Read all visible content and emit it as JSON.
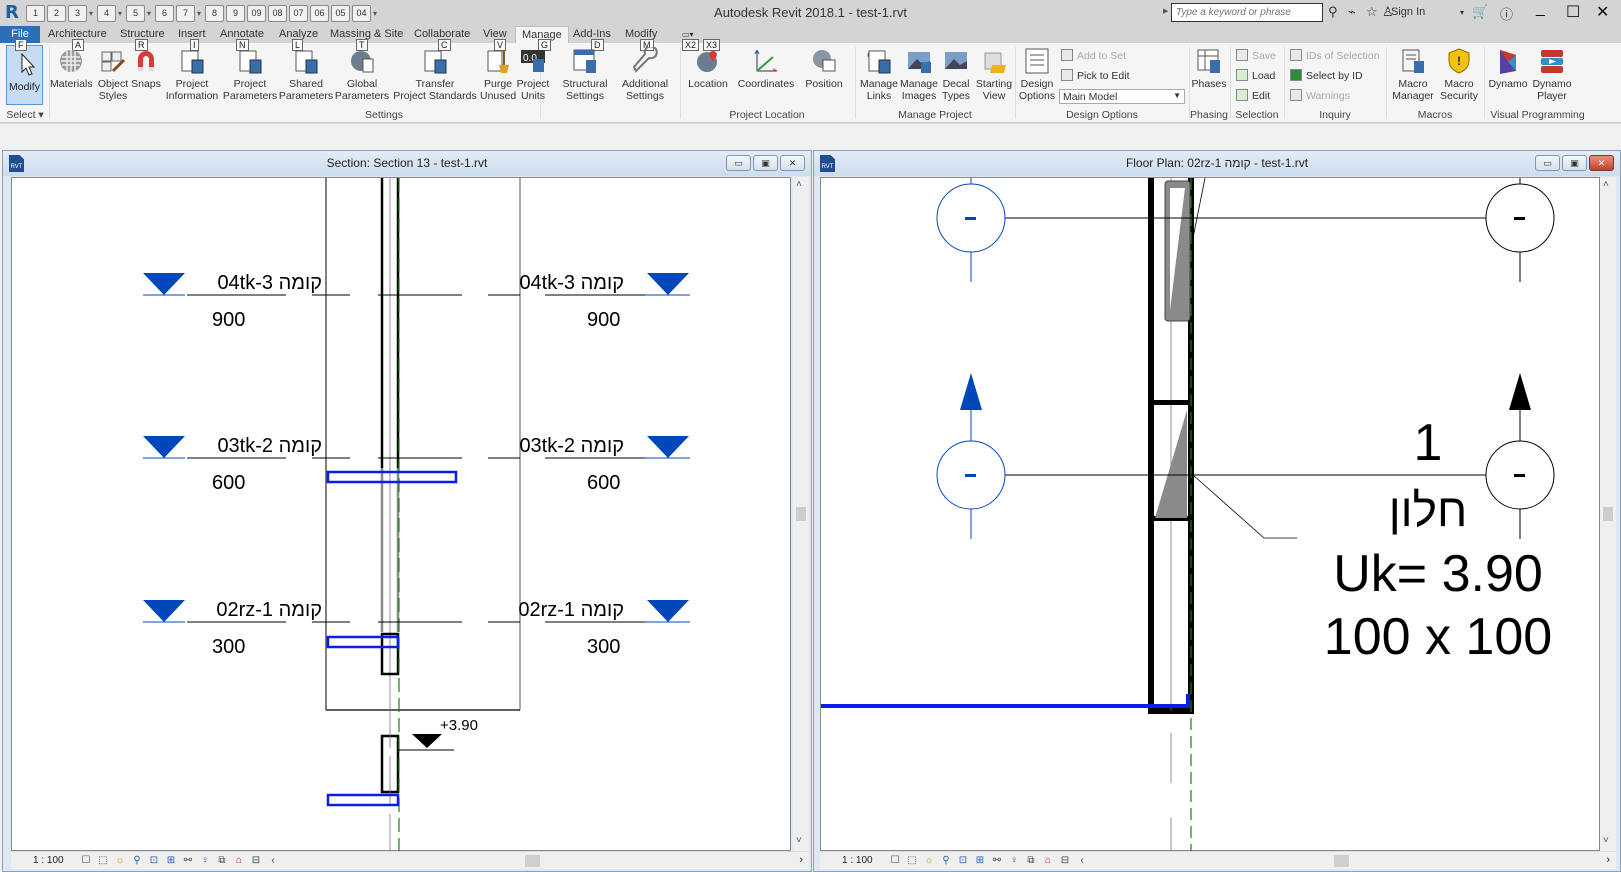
{
  "app": {
    "title": "Autodesk Revit 2018.1 -     test-1.rvt",
    "logo": "R",
    "search_placeholder": "Type a keyword or phrase",
    "sign_in": "Sign In",
    "icons": [
      "binoculars-icon",
      "satellite-icon",
      "star-icon",
      "user-icon",
      "cart-icon",
      "help-icon"
    ]
  },
  "quick_access": [
    "1",
    "2",
    "3",
    "4",
    "5",
    "6",
    "7",
    "8",
    "9",
    "09",
    "08",
    "07",
    "06",
    "05",
    "04"
  ],
  "tabs": [
    {
      "label": "File",
      "key": "F"
    },
    {
      "label": "Architecture",
      "key": "A"
    },
    {
      "label": "Structure",
      "key": "R"
    },
    {
      "label": "Insert",
      "key": "I"
    },
    {
      "label": "Annotate",
      "key": "N"
    },
    {
      "label": "Analyze",
      "key": "L"
    },
    {
      "label": "Massing & Site",
      "key": "T"
    },
    {
      "label": "Collaborate",
      "key": "C"
    },
    {
      "label": "View",
      "key": "V"
    },
    {
      "label": "Manage",
      "key": "G"
    },
    {
      "label": "Add-Ins",
      "key": "D"
    },
    {
      "label": "Modify",
      "key": "M"
    }
  ],
  "extra_keytips": [
    "X2",
    "X3"
  ],
  "ribbon": {
    "select": {
      "modify": "Modify",
      "label": "Select ▾"
    },
    "settings": {
      "label": "Settings",
      "buttons": [
        {
          "l1": "Materials",
          "l2": ""
        },
        {
          "l1": "Object",
          "l2": "Styles"
        },
        {
          "l1": "Snaps",
          "l2": ""
        },
        {
          "l1": "Project",
          "l2": "Information"
        },
        {
          "l1": "Project",
          "l2": "Parameters"
        },
        {
          "l1": "Shared",
          "l2": "Parameters"
        },
        {
          "l1": "Global",
          "l2": "Parameters"
        },
        {
          "l1": "Transfer",
          "l2": "Project Standards"
        },
        {
          "l1": "Purge",
          "l2": "Unused"
        },
        {
          "l1": "Project",
          "l2": "Units"
        },
        {
          "l1": "Structural",
          "l2": "Settings"
        },
        {
          "l1": "Additional",
          "l2": "Settings"
        }
      ]
    },
    "project_location": {
      "label": "Project Location",
      "buttons": [
        {
          "l1": "Location"
        },
        {
          "l1": "Coordinates"
        },
        {
          "l1": "Position"
        }
      ]
    },
    "manage_project": {
      "label": "Manage Project",
      "buttons": [
        {
          "l1": "Manage",
          "l2": "Links"
        },
        {
          "l1": "Manage",
          "l2": "Images"
        },
        {
          "l1": "Decal",
          "l2": "Types"
        },
        {
          "l1": "Starting",
          "l2": "View"
        }
      ]
    },
    "design_options": {
      "label": "Design Options",
      "button": {
        "l1": "Design",
        "l2": "Options"
      },
      "add_to_set": "Add to Set",
      "pick_to_edit": "Pick to Edit",
      "current": "Main Model"
    },
    "phasing": {
      "label": "Phasing",
      "button": "Phases"
    },
    "selection": {
      "label": "Selection",
      "save": "Save",
      "load": "Load",
      "edit": "Edit"
    },
    "inquiry": {
      "label": "Inquiry",
      "ids": "IDs of Selection",
      "select_by_id": "Select  by ID",
      "warnings": "Warnings"
    },
    "macros": {
      "label": "Macros",
      "buttons": [
        {
          "l1": "Macro",
          "l2": "Manager"
        },
        {
          "l1": "Macro",
          "l2": "Security"
        }
      ]
    },
    "visual_programming": {
      "label": "Visual Programming",
      "buttons": [
        {
          "l1": "Dynamo",
          "l2": ""
        },
        {
          "l1": "Dynamo",
          "l2": "Player"
        }
      ]
    }
  },
  "views": {
    "section": {
      "title": "Section: Section 13 - test-1.rvt",
      "scale": "1 : 100",
      "levels": [
        {
          "name": "04tk-קומה 3",
          "elevation": "900"
        },
        {
          "name": "03tk-קומה 2",
          "elevation": "600"
        },
        {
          "name": "02rz-קומה 1",
          "elevation": "300"
        }
      ],
      "spot_elevation": "+3.90"
    },
    "plan": {
      "title": "Floor Plan: 02rz-1 קומה - test-1.rvt",
      "scale": "1 : 100",
      "grid_bubble_label": "-",
      "window_tag": {
        "number": "1",
        "name": "חלון",
        "uk": "Uk= 3.90",
        "size": "100 x 100"
      }
    }
  },
  "colors": {
    "file_tab": "#2a70b8",
    "level_marker": "#0047bb",
    "structure_blue": "#0a1ee6",
    "green_dashed": "#0a8a0a"
  }
}
